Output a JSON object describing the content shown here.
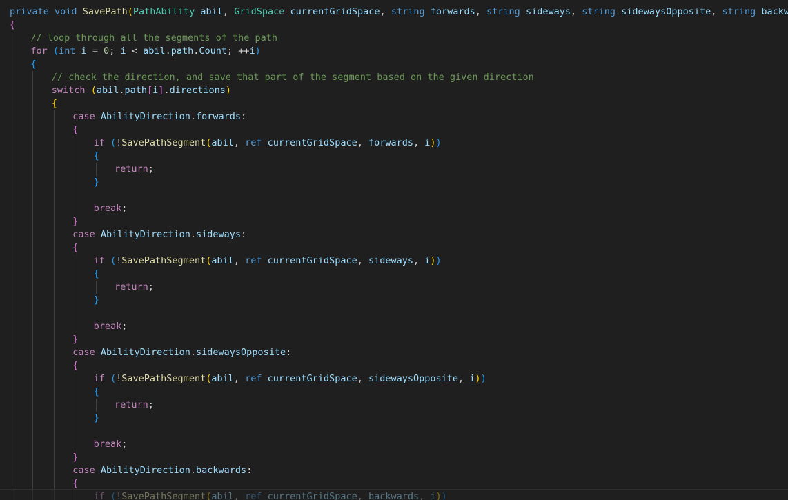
{
  "code": {
    "lines": [
      {
        "indent": 0,
        "tokens": [
          {
            "t": "private",
            "c": "kw"
          },
          {
            "t": " ",
            "c": "plain"
          },
          {
            "t": "void",
            "c": "kw"
          },
          {
            "t": " ",
            "c": "plain"
          },
          {
            "t": "SavePath",
            "c": "fn"
          },
          {
            "t": "(",
            "c": "b1"
          },
          {
            "t": "PathAbility",
            "c": "type"
          },
          {
            "t": " ",
            "c": "plain"
          },
          {
            "t": "abil",
            "c": "var"
          },
          {
            "t": ", ",
            "c": "plain"
          },
          {
            "t": "GridSpace",
            "c": "type"
          },
          {
            "t": " ",
            "c": "plain"
          },
          {
            "t": "currentGridSpace",
            "c": "var"
          },
          {
            "t": ", ",
            "c": "plain"
          },
          {
            "t": "string",
            "c": "kw"
          },
          {
            "t": " ",
            "c": "plain"
          },
          {
            "t": "forwards",
            "c": "var"
          },
          {
            "t": ", ",
            "c": "plain"
          },
          {
            "t": "string",
            "c": "kw"
          },
          {
            "t": " ",
            "c": "plain"
          },
          {
            "t": "sideways",
            "c": "var"
          },
          {
            "t": ", ",
            "c": "plain"
          },
          {
            "t": "string",
            "c": "kw"
          },
          {
            "t": " ",
            "c": "plain"
          },
          {
            "t": "sidewaysOpposite",
            "c": "var"
          },
          {
            "t": ", ",
            "c": "plain"
          },
          {
            "t": "string",
            "c": "kw"
          },
          {
            "t": " ",
            "c": "plain"
          },
          {
            "t": "backwards",
            "c": "var"
          },
          {
            "t": ")",
            "c": "b1"
          }
        ]
      },
      {
        "indent": 0,
        "tokens": [
          {
            "t": "{",
            "c": "b2"
          }
        ]
      },
      {
        "indent": 1,
        "tokens": [
          {
            "t": "// loop through all the segments of the path",
            "c": "cmt"
          }
        ]
      },
      {
        "indent": 1,
        "tokens": [
          {
            "t": "for",
            "c": "ctl"
          },
          {
            "t": " ",
            "c": "plain"
          },
          {
            "t": "(",
            "c": "b3"
          },
          {
            "t": "int",
            "c": "kw"
          },
          {
            "t": " ",
            "c": "plain"
          },
          {
            "t": "i",
            "c": "var"
          },
          {
            "t": " = ",
            "c": "plain"
          },
          {
            "t": "0",
            "c": "num"
          },
          {
            "t": "; ",
            "c": "plain"
          },
          {
            "t": "i",
            "c": "var"
          },
          {
            "t": " < ",
            "c": "plain"
          },
          {
            "t": "abil",
            "c": "var"
          },
          {
            "t": ".",
            "c": "plain"
          },
          {
            "t": "path",
            "c": "var"
          },
          {
            "t": ".",
            "c": "plain"
          },
          {
            "t": "Count",
            "c": "var"
          },
          {
            "t": "; ++",
            "c": "plain"
          },
          {
            "t": "i",
            "c": "var"
          },
          {
            "t": ")",
            "c": "b3"
          }
        ]
      },
      {
        "indent": 1,
        "tokens": [
          {
            "t": "{",
            "c": "b3"
          }
        ]
      },
      {
        "indent": 2,
        "tokens": [
          {
            "t": "// check the direction, and save that part of the segment based on the given direction",
            "c": "cmt"
          }
        ]
      },
      {
        "indent": 2,
        "tokens": [
          {
            "t": "switch",
            "c": "ctl"
          },
          {
            "t": " ",
            "c": "plain"
          },
          {
            "t": "(",
            "c": "b1"
          },
          {
            "t": "abil",
            "c": "var"
          },
          {
            "t": ".",
            "c": "plain"
          },
          {
            "t": "path",
            "c": "var"
          },
          {
            "t": "[",
            "c": "b2"
          },
          {
            "t": "i",
            "c": "var"
          },
          {
            "t": "]",
            "c": "b2"
          },
          {
            "t": ".",
            "c": "plain"
          },
          {
            "t": "directions",
            "c": "var"
          },
          {
            "t": ")",
            "c": "b1"
          }
        ]
      },
      {
        "indent": 2,
        "tokens": [
          {
            "t": "{",
            "c": "b1"
          }
        ]
      },
      {
        "indent": 3,
        "tokens": [
          {
            "t": "case",
            "c": "ctl"
          },
          {
            "t": " ",
            "c": "plain"
          },
          {
            "t": "AbilityDirection",
            "c": "var"
          },
          {
            "t": ".",
            "c": "plain"
          },
          {
            "t": "forwards",
            "c": "var"
          },
          {
            "t": ":",
            "c": "plain"
          }
        ]
      },
      {
        "indent": 3,
        "tokens": [
          {
            "t": "{",
            "c": "b2"
          }
        ]
      },
      {
        "indent": 4,
        "tokens": [
          {
            "t": "if",
            "c": "ctl"
          },
          {
            "t": " ",
            "c": "plain"
          },
          {
            "t": "(",
            "c": "b3"
          },
          {
            "t": "!",
            "c": "plain"
          },
          {
            "t": "SavePathSegment",
            "c": "fn"
          },
          {
            "t": "(",
            "c": "b1"
          },
          {
            "t": "abil",
            "c": "var"
          },
          {
            "t": ", ",
            "c": "plain"
          },
          {
            "t": "ref",
            "c": "kw"
          },
          {
            "t": " ",
            "c": "plain"
          },
          {
            "t": "currentGridSpace",
            "c": "var"
          },
          {
            "t": ", ",
            "c": "plain"
          },
          {
            "t": "forwards",
            "c": "var"
          },
          {
            "t": ", ",
            "c": "plain"
          },
          {
            "t": "i",
            "c": "var"
          },
          {
            "t": ")",
            "c": "b1"
          },
          {
            "t": ")",
            "c": "b3"
          }
        ]
      },
      {
        "indent": 4,
        "tokens": [
          {
            "t": "{",
            "c": "b3"
          }
        ]
      },
      {
        "indent": 5,
        "tokens": [
          {
            "t": "return",
            "c": "ctl"
          },
          {
            "t": ";",
            "c": "plain"
          }
        ]
      },
      {
        "indent": 4,
        "tokens": [
          {
            "t": "}",
            "c": "b3"
          }
        ]
      },
      {
        "indent": 4,
        "tokens": []
      },
      {
        "indent": 4,
        "tokens": [
          {
            "t": "break",
            "c": "ctl"
          },
          {
            "t": ";",
            "c": "plain"
          }
        ]
      },
      {
        "indent": 3,
        "tokens": [
          {
            "t": "}",
            "c": "b2"
          }
        ]
      },
      {
        "indent": 3,
        "tokens": [
          {
            "t": "case",
            "c": "ctl"
          },
          {
            "t": " ",
            "c": "plain"
          },
          {
            "t": "AbilityDirection",
            "c": "var"
          },
          {
            "t": ".",
            "c": "plain"
          },
          {
            "t": "sideways",
            "c": "var"
          },
          {
            "t": ":",
            "c": "plain"
          }
        ]
      },
      {
        "indent": 3,
        "tokens": [
          {
            "t": "{",
            "c": "b2"
          }
        ]
      },
      {
        "indent": 4,
        "tokens": [
          {
            "t": "if",
            "c": "ctl"
          },
          {
            "t": " ",
            "c": "plain"
          },
          {
            "t": "(",
            "c": "b3"
          },
          {
            "t": "!",
            "c": "plain"
          },
          {
            "t": "SavePathSegment",
            "c": "fn"
          },
          {
            "t": "(",
            "c": "b1"
          },
          {
            "t": "abil",
            "c": "var"
          },
          {
            "t": ", ",
            "c": "plain"
          },
          {
            "t": "ref",
            "c": "kw"
          },
          {
            "t": " ",
            "c": "plain"
          },
          {
            "t": "currentGridSpace",
            "c": "var"
          },
          {
            "t": ", ",
            "c": "plain"
          },
          {
            "t": "sideways",
            "c": "var"
          },
          {
            "t": ", ",
            "c": "plain"
          },
          {
            "t": "i",
            "c": "var"
          },
          {
            "t": ")",
            "c": "b1"
          },
          {
            "t": ")",
            "c": "b3"
          }
        ]
      },
      {
        "indent": 4,
        "tokens": [
          {
            "t": "{",
            "c": "b3"
          }
        ]
      },
      {
        "indent": 5,
        "tokens": [
          {
            "t": "return",
            "c": "ctl"
          },
          {
            "t": ";",
            "c": "plain"
          }
        ]
      },
      {
        "indent": 4,
        "tokens": [
          {
            "t": "}",
            "c": "b3"
          }
        ]
      },
      {
        "indent": 4,
        "tokens": []
      },
      {
        "indent": 4,
        "tokens": [
          {
            "t": "break",
            "c": "ctl"
          },
          {
            "t": ";",
            "c": "plain"
          }
        ]
      },
      {
        "indent": 3,
        "tokens": [
          {
            "t": "}",
            "c": "b2"
          }
        ]
      },
      {
        "indent": 3,
        "tokens": [
          {
            "t": "case",
            "c": "ctl"
          },
          {
            "t": " ",
            "c": "plain"
          },
          {
            "t": "AbilityDirection",
            "c": "var"
          },
          {
            "t": ".",
            "c": "plain"
          },
          {
            "t": "sidewaysOpposite",
            "c": "var"
          },
          {
            "t": ":",
            "c": "plain"
          }
        ]
      },
      {
        "indent": 3,
        "tokens": [
          {
            "t": "{",
            "c": "b2"
          }
        ]
      },
      {
        "indent": 4,
        "tokens": [
          {
            "t": "if",
            "c": "ctl"
          },
          {
            "t": " ",
            "c": "plain"
          },
          {
            "t": "(",
            "c": "b3"
          },
          {
            "t": "!",
            "c": "plain"
          },
          {
            "t": "SavePathSegment",
            "c": "fn"
          },
          {
            "t": "(",
            "c": "b1"
          },
          {
            "t": "abil",
            "c": "var"
          },
          {
            "t": ", ",
            "c": "plain"
          },
          {
            "t": "ref",
            "c": "kw"
          },
          {
            "t": " ",
            "c": "plain"
          },
          {
            "t": "currentGridSpace",
            "c": "var"
          },
          {
            "t": ", ",
            "c": "plain"
          },
          {
            "t": "sidewaysOpposite",
            "c": "var"
          },
          {
            "t": ", ",
            "c": "plain"
          },
          {
            "t": "i",
            "c": "var"
          },
          {
            "t": ")",
            "c": "b1"
          },
          {
            "t": ")",
            "c": "b3"
          }
        ]
      },
      {
        "indent": 4,
        "tokens": [
          {
            "t": "{",
            "c": "b3"
          }
        ]
      },
      {
        "indent": 5,
        "tokens": [
          {
            "t": "return",
            "c": "ctl"
          },
          {
            "t": ";",
            "c": "plain"
          }
        ]
      },
      {
        "indent": 4,
        "tokens": [
          {
            "t": "}",
            "c": "b3"
          }
        ]
      },
      {
        "indent": 4,
        "tokens": []
      },
      {
        "indent": 4,
        "tokens": [
          {
            "t": "break",
            "c": "ctl"
          },
          {
            "t": ";",
            "c": "plain"
          }
        ]
      },
      {
        "indent": 3,
        "tokens": [
          {
            "t": "}",
            "c": "b2"
          }
        ]
      },
      {
        "indent": 3,
        "tokens": [
          {
            "t": "case",
            "c": "ctl"
          },
          {
            "t": " ",
            "c": "plain"
          },
          {
            "t": "AbilityDirection",
            "c": "var"
          },
          {
            "t": ".",
            "c": "plain"
          },
          {
            "t": "backwards",
            "c": "var"
          },
          {
            "t": ":",
            "c": "plain"
          }
        ]
      },
      {
        "indent": 3,
        "tokens": [
          {
            "t": "{",
            "c": "b2"
          }
        ]
      },
      {
        "indent": 4,
        "tokens": [
          {
            "t": "if",
            "c": "ctl"
          },
          {
            "t": " ",
            "c": "plain"
          },
          {
            "t": "(",
            "c": "b3"
          },
          {
            "t": "!",
            "c": "plain"
          },
          {
            "t": "SavePathSegment",
            "c": "fn"
          },
          {
            "t": "(",
            "c": "b1"
          },
          {
            "t": "abil",
            "c": "var"
          },
          {
            "t": ", ",
            "c": "plain"
          },
          {
            "t": "ref",
            "c": "kw"
          },
          {
            "t": " ",
            "c": "plain"
          },
          {
            "t": "currentGridSpace",
            "c": "var"
          },
          {
            "t": ", ",
            "c": "plain"
          },
          {
            "t": "backwards",
            "c": "var"
          },
          {
            "t": ", ",
            "c": "plain"
          },
          {
            "t": "i",
            "c": "var"
          },
          {
            "t": ")",
            "c": "b1"
          },
          {
            "t": ")",
            "c": "b3"
          }
        ]
      }
    ]
  },
  "colors": {
    "background": "#1f1f1f",
    "keyword": "#569cd6",
    "control": "#c586c0",
    "function": "#dcdcaa",
    "type": "#4ec9b0",
    "variable": "#9cdcfe",
    "number": "#b5cea8",
    "comment": "#6a9955",
    "bracket_gold": "#ffd700",
    "bracket_orchid": "#da70d6",
    "bracket_blue": "#179fff"
  }
}
